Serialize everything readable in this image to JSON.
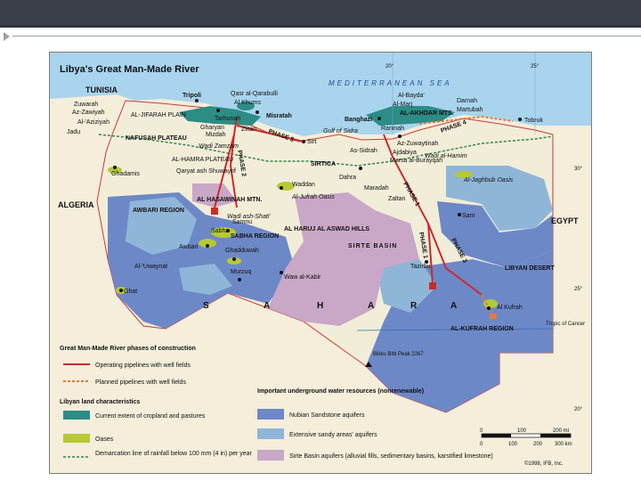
{
  "title": "Libya's Great Man-Made River",
  "sea": "MEDITERRANEAN SEA",
  "gulf": "Gulf of Sidra",
  "countries": {
    "tunisia": "TUNISIA",
    "algeria": "ALGERIA",
    "egypt": "EGYPT"
  },
  "regions": {
    "awbari": "AWBARI REGION",
    "sabha": "SABHA REGION",
    "kufrah": "AL-KUFRAH REGION",
    "sirte_basin": "SIRTE BASIN",
    "sirtica": "SIRTICA",
    "libyan_desert": "LIBYAN DESERT",
    "nafusah": "NAFUSAH PLATEAU",
    "hamra": "AL-HAMRA PLATEAU",
    "hasawinah": "AL HASAWINAH MTN.",
    "haruj": "AL HARUJ AL ASWAD HILLS",
    "jifarah": "AL-JIFARAH PLAIN",
    "akhdar": "AL-AKHDAR MTS.",
    "sahara": [
      "S",
      "A",
      "H",
      "A",
      "R",
      "A"
    ]
  },
  "cities": [
    "Tripoli",
    "Zuwarah",
    "Az-Zawiyah",
    "Al-'Aziziyah",
    "Jadu",
    "Mizdah",
    "Tarhunah",
    "Gharyan",
    "Zlitan",
    "Al Khums",
    "Misratah",
    "Qasr al-Qarabulli",
    "Ghadamis",
    "Qaryat ash Shuwayrif",
    "Sirt",
    "As-Sidrah",
    "Banghazi",
    "Al-Marj",
    "Al-Bayda'",
    "Darnah",
    "Martubah",
    "Tobruk",
    "Raninah",
    "Az-Zuwaytinah",
    "Ajdabiya",
    "Marsa al-Burayqah",
    "Dahra",
    "Maradah",
    "Zaltan",
    "Waddan",
    "Al-Jufrah Oasis",
    "Samnu",
    "Sabha",
    "Awbari",
    "Ghadduwah",
    "Al-'Uwaynat",
    "Ghat",
    "Murzuq",
    "Waw al-Kabir",
    "Tazirbu",
    "Sarir",
    "Al-Jaghbub Oasis",
    "Al Kufrah",
    "Bikku Bitti Peak 2267"
  ],
  "phases": [
    "PHASE 1",
    "PHASE 1",
    "PHASE 2",
    "PHASE 3",
    "PHASE 4",
    "PHASE 5"
  ],
  "features": {
    "wadi_zamzam": "Wadi Zamzam",
    "wadi_shati": "Wadi ash-Shati'",
    "wadi_hamim": "Wadi al-Hamim",
    "tropic": "Tropic of Cancer"
  },
  "grid_labels": {
    "lon20": "20°",
    "lon25": "25°",
    "lat30": "30°",
    "lat25": "25°",
    "lat20": "20°"
  },
  "legend": {
    "gmr_title": "Great Man-Made River phases of construction",
    "operating": "Operating pipelines with well fields",
    "planned": "Planned pipelines with well fields",
    "land_title": "Libyan land characteristics",
    "cropland": "Current extent of cropland and pastures",
    "oases": "Oases",
    "rainfall": "Demarcation line of rainfall below 100 mm (4 in) per year",
    "water_title": "Important underground water resources (nonrenewable)",
    "nubian": "Nubian Sandstone aquifers",
    "sandy": "Extensive sandy areas' aquifers",
    "sirte": "Sirte Basin aquifers (alluvial fills, sedimentary basins, karstified limestone)"
  },
  "scale": {
    "mi": [
      "0",
      "100",
      "200 mi"
    ],
    "km": [
      "0",
      "100",
      "200",
      "300 km"
    ]
  },
  "copyright": "©1998, IFB, Inc.",
  "colors": {
    "sea": "#a9d4ee",
    "land": "#f4eeda",
    "nubian": "#6d88c7",
    "sandy": "#8fb6d9",
    "sirte": "#c9a7c7",
    "cropland": "#2c8c86",
    "oases": "#b7c934",
    "pipeline": "#cc2a2a",
    "planned": "#e27a3a",
    "rain": "#2f8a4a"
  }
}
